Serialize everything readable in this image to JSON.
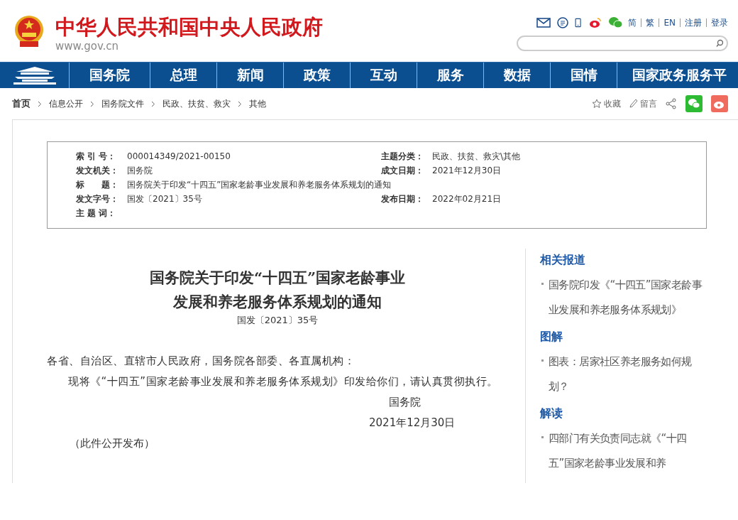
{
  "header": {
    "site_title": "中华人民共和国中央人民政府",
    "site_url": "www.gov.cn",
    "links": [
      "简",
      "繁",
      "EN",
      "注册",
      "登录"
    ]
  },
  "nav": {
    "items": [
      "国务院",
      "总理",
      "新闻",
      "政策",
      "互动",
      "服务",
      "数据",
      "国情",
      "国家政务服务平"
    ]
  },
  "breadcrumb": [
    "首页",
    "信息公开",
    "国务院文件",
    "民政、扶贫、救灾",
    "其他"
  ],
  "tools": {
    "favorite": "收藏",
    "comment": "留言"
  },
  "info": [
    {
      "label": "索 引 号：",
      "value": "000014349/2021-00150",
      "label2": "主题分类：",
      "value2": "民政、扶贫、救灾\\其他"
    },
    {
      "label": "发文机关：",
      "value": "国务院",
      "label2": "成文日期：",
      "value2": "2021年12月30日"
    },
    {
      "label": "标　　题：",
      "value": "国务院关于印发“十四五”国家老龄事业发展和养老服务体系规划的通知"
    },
    {
      "label": "发文字号：",
      "value": "国发〔2021〕35号",
      "label2": "发布日期：",
      "value2": "2022年02月21日"
    },
    {
      "label": "主 题 词："
    }
  ],
  "article": {
    "title_lines": [
      "国务院关于印发“十四五”国家老龄事业",
      "发展和养老服务体系规划的通知"
    ],
    "doc_number": "国发〔2021〕35号",
    "salutation": "各省、自治区、直辖市人民政府，国务院各部委、各直属机构：",
    "body": "现将《“十四五”国家老龄事业发展和养老服务体系规划》印发给你们，请认真贯彻执行。",
    "signer": "国务院",
    "date": "2021年12月30日",
    "note": "（此件公开发布）"
  },
  "sidebar": [
    {
      "heading": "相关报道",
      "items": [
        "国务院印发《“十四五”国家老龄事业发展和养老服务体系规划》"
      ]
    },
    {
      "heading": "图解",
      "items": [
        "图表：居家社区养老服务如何规划？"
      ]
    },
    {
      "heading": "解读",
      "items": [
        "四部门有关负责同志就《“十四五”国家老龄事业发展和养"
      ]
    }
  ]
}
